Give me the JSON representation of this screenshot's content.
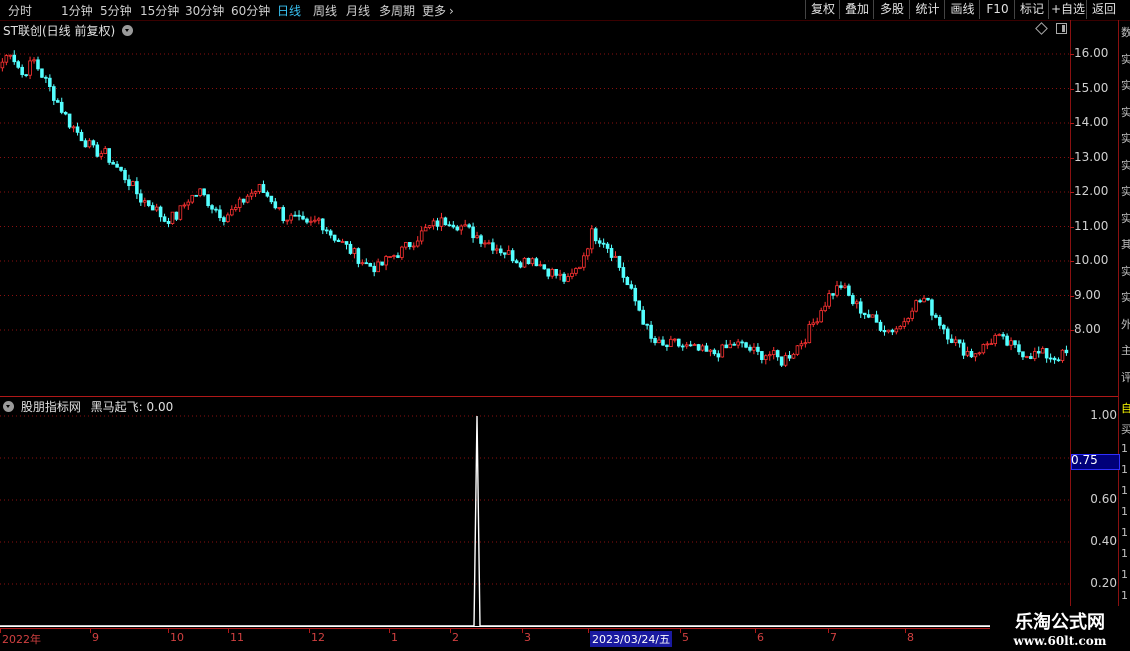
{
  "toolbar": {
    "periods": [
      "分时",
      "1分钟",
      "5分钟",
      "15分钟",
      "30分钟",
      "60分钟",
      "日线",
      "周线",
      "月线",
      "多周期",
      "更多"
    ],
    "more_icon": "chevron-right-icon",
    "right_buttons": [
      "复权",
      "叠加",
      "多股",
      "统计",
      "画线",
      "F10",
      "标记",
      "+自选",
      "返回"
    ]
  },
  "main_panel": {
    "title": "ST联创(日线 前复权)",
    "y_labels": [
      "16.00",
      "15.00",
      "14.00",
      "13.00",
      "12.00",
      "11.00",
      "10.00",
      "9.00",
      "8.00"
    ],
    "up_color": "#ff3232",
    "down_color": "#54ffff"
  },
  "indicator_panel": {
    "title": "股朋指标网",
    "indicator_label": "黑马起飞: 0.00",
    "y_labels": [
      "1.00",
      "0.75",
      "0.60",
      "0.40",
      "0.20"
    ],
    "highlight_label": "0.75",
    "side_labels": [
      "自",
      "买",
      "1",
      "1",
      "1",
      "1",
      "1",
      "1",
      "1",
      "1"
    ]
  },
  "x_axis": {
    "labels": [
      "2022年",
      "9",
      "10",
      "11",
      "12",
      "1",
      "2",
      "3",
      "2023/03/24/五",
      "5",
      "6",
      "7",
      "8"
    ]
  },
  "right_side_chars": [
    "数",
    "实",
    "实",
    "实",
    "实",
    "实",
    "实",
    "实",
    "其",
    "实",
    "实",
    "外",
    "主",
    "评"
  ],
  "watermark": {
    "line1": "乐淘公式网",
    "line2": "www.60lt.com"
  },
  "chart_data": [
    {
      "type": "candlestick",
      "title": "ST联创(日线 前复权)",
      "ylim": [
        7.0,
        16.4
      ],
      "y_ticks": [
        16,
        15,
        14,
        13,
        12,
        11,
        10,
        9,
        8
      ],
      "x_labels": [
        "2022年",
        "9",
        "10",
        "11",
        "12",
        "1",
        "2",
        "3",
        "5",
        "6",
        "7",
        "8"
      ],
      "close_series": [
        15.6,
        16.1,
        15.4,
        15.8,
        15.2,
        14.6,
        14.0,
        13.6,
        13.2,
        13.1,
        12.7,
        12.3,
        11.8,
        11.6,
        11.2,
        11.3,
        11.8,
        12.0,
        11.6,
        11.3,
        11.5,
        11.9,
        12.1,
        11.8,
        11.3,
        11.2,
        11.0,
        11.2,
        10.8,
        10.5,
        10.2,
        9.9,
        9.8,
        10.1,
        10.3,
        10.6,
        10.9,
        11.1,
        11.2,
        11.0,
        10.8,
        10.6,
        10.4,
        10.2,
        10.0,
        10.1,
        9.8,
        9.6,
        9.4,
        9.9,
        10.8,
        10.6,
        10.1,
        9.3,
        8.6,
        7.7,
        7.5,
        7.6,
        7.5,
        7.4,
        7.3,
        7.4,
        7.6,
        7.5,
        7.3,
        7.3,
        7.1,
        7.4,
        7.8,
        8.4,
        9.0,
        9.3,
        8.8,
        8.5,
        8.2,
        8.0,
        8.1,
        8.7,
        8.9,
        8.4,
        7.9,
        7.5,
        7.3,
        7.5,
        7.8,
        7.6,
        7.4,
        7.3,
        7.3,
        7.2,
        7.3
      ]
    },
    {
      "type": "line",
      "title": "黑马起飞",
      "ylim": [
        0,
        1.0
      ],
      "y_ticks": [
        1.0,
        0.8,
        0.6,
        0.4,
        0.2
      ],
      "spike_date": "2023/03/24",
      "spike_value": 1.0,
      "baseline_value": 0.0
    }
  ]
}
